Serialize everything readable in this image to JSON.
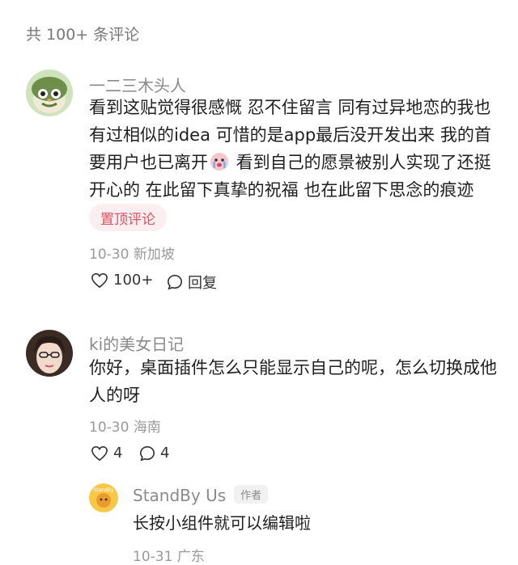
{
  "header": {
    "count_text": "共 100+ 条评论"
  },
  "comments": [
    {
      "user": "一二三木头人",
      "text_lines": [
        "看到这贴觉得很感慨 忍不住留言 同有过异地恋的我也",
        "有过相似的idea 可惜的是app最后没开发出来 我的首",
        "要用户也已离开",
        " 看到自己的愿景被别人实现了还挺",
        "开心的 在此留下真挚的祝福 也在此留下思念的痕迹"
      ],
      "pin_tag": "置顶评论",
      "date": "10-30",
      "location": "新加坡",
      "likes": "100+",
      "reply_label": "回复",
      "emoji_icon": "crying-face-icon"
    },
    {
      "user": "ki的美女日记",
      "text_lines": [
        "你好，桌面插件怎么只能显示自己的呢，怎么切换成他",
        "人的呀"
      ],
      "date": "10-30",
      "location": "海南",
      "likes": "4",
      "replies": "4"
    }
  ],
  "reply": {
    "user": "StandBy Us",
    "author_tag": "作者",
    "text": "长按小组件就可以编辑啦",
    "date": "10-31",
    "location": "广东",
    "avatar_text": "StandBy"
  },
  "colors": {
    "pin_tag_bg": "#fbeef0",
    "pin_tag_text": "#e0525f",
    "username": "#8a8a8a",
    "meta": "#9a9a9a"
  }
}
